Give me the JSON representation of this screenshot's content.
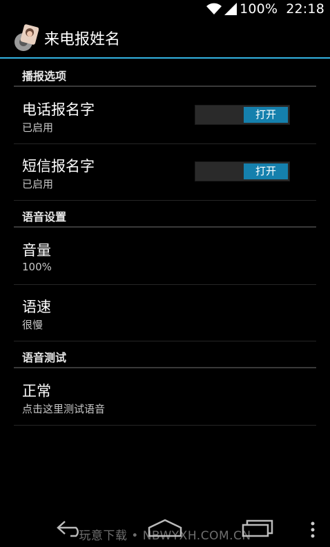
{
  "status_bar": {
    "battery_text": "100%",
    "time": "22:18",
    "icons": [
      "wifi-icon",
      "signal-icon"
    ]
  },
  "app": {
    "title": "来电报姓名",
    "icon": "app-avatar-icon",
    "accent_color": "#33b5e5"
  },
  "sections": {
    "broadcast": {
      "header": "播报选项",
      "items": [
        {
          "title": "电话报名字",
          "summary": "已启用",
          "switch_label": "打开"
        },
        {
          "title": "短信报名字",
          "summary": "已启用",
          "switch_label": "打开"
        }
      ]
    },
    "voice": {
      "header": "语音设置",
      "items": [
        {
          "title": "音量",
          "summary": "100%"
        },
        {
          "title": "语速",
          "summary": "很慢"
        }
      ]
    },
    "test": {
      "header": "语音测试",
      "items": [
        {
          "title": "正常",
          "summary": "点击这里测试语音"
        }
      ]
    }
  },
  "nav_bar": {
    "icons": [
      "back-icon",
      "home-icon",
      "recents-icon",
      "overflow-menu-icon"
    ]
  },
  "watermark": "玩意下载 • NBWYXH.COM.CN"
}
